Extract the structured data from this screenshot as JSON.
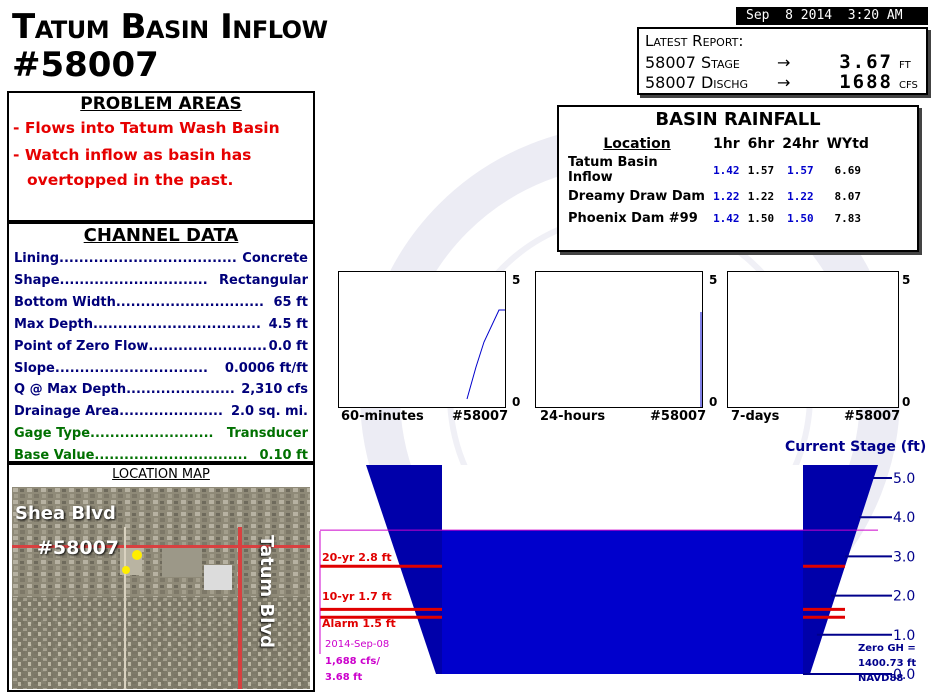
{
  "title": {
    "line1": "Tatum Basin Inflow",
    "line2": "#58007"
  },
  "datetime": "Sep  8 2014  3:20 AM",
  "latest_report": {
    "heading": "Latest Report:",
    "rows": [
      {
        "label": "58007 Stage",
        "arrow": "→",
        "value": "3.67",
        "unit": "FT"
      },
      {
        "label": "58007 Dischg",
        "arrow": "→",
        "value": "1688",
        "unit": "CFS"
      }
    ]
  },
  "problem_areas": {
    "heading": "PROBLEM AREAS",
    "items": [
      "- Flows into Tatum Wash Basin",
      "- Watch inflow as basin has",
      "overtopped in the past."
    ]
  },
  "channel_data": {
    "heading": "CHANNEL DATA",
    "rows": [
      {
        "label": "Lining",
        "dots": "....................................",
        "value": "Concrete"
      },
      {
        "label": "Shape",
        "dots": "..............................",
        "value": "Rectangular"
      },
      {
        "label": "Bottom Width",
        "dots": "..............................",
        "value": "65 ft"
      },
      {
        "label": "Max Depth",
        "dots": "..................................",
        "value": "4.5 ft"
      },
      {
        "label": "Point of Zero Flow",
        "dots": "........................",
        "value": "0.0 ft"
      },
      {
        "label": "Slope",
        "dots": "...............................",
        "value": "0.0006 ft/ft"
      },
      {
        "label": "Q @ Max Depth",
        "dots": "......................",
        "value": "2,310 cfs"
      },
      {
        "label": "Drainage Area",
        "dots": ".....................",
        "value": "2.0 sq. mi."
      },
      {
        "label": "Gage Type",
        "dots": ".........................",
        "value": "Transducer"
      },
      {
        "label": "Base Value",
        "dots": "...............................",
        "value": "0.10 ft"
      }
    ]
  },
  "location_map": {
    "heading": "LOCATION MAP",
    "road1": "Shea Blvd",
    "road2": "Tatum Blvd",
    "gage_label": "#58007"
  },
  "basin_rainfall": {
    "heading": "BASIN RAINFALL",
    "columns": [
      "Location",
      "1hr",
      "6hr",
      "24hr",
      "WYtd"
    ],
    "rows": [
      {
        "name": "Tatum Basin Inflow",
        "v1": "1.42",
        "v6": "1.57",
        "v24": "1.57",
        "wy": "6.69"
      },
      {
        "name": "Dreamy Draw Dam",
        "v1": "1.22",
        "v6": "1.22",
        "v24": "1.22",
        "wy": "8.07"
      },
      {
        "name": "Phoenix Dam #99",
        "v1": "1.42",
        "v6": "1.50",
        "v24": "1.50",
        "wy": "7.83"
      }
    ]
  },
  "mini_charts": [
    {
      "label": "60-minutes",
      "id": "#58007",
      "ymax": "5",
      "ymin": "0"
    },
    {
      "label": "24-hours",
      "id": "#58007",
      "ymax": "5",
      "ymin": "0"
    },
    {
      "label": "7-days",
      "id": "#58007",
      "ymax": "5",
      "ymin": "0"
    }
  ],
  "stage_diagram": {
    "title": "Current Stage (ft)",
    "current_stage": 3.67,
    "max_scale": 5.0,
    "ticks": [
      "5.0",
      "4.0",
      "3.0",
      "2.0",
      "1.0",
      "0.0"
    ],
    "thresholds": [
      {
        "label": "20-yr 2.8 ft",
        "value": 2.8
      },
      {
        "label": "10-yr 1.7 ft",
        "value": 1.7
      },
      {
        "label": "Alarm 1.5 ft",
        "value": 1.5
      }
    ],
    "reading": {
      "date": "2014-Sep-08",
      "flow": "1,688 cfs/",
      "stage": "3.68 ft"
    },
    "zero_gh": [
      "Zero GH =",
      "1400.73 ft",
      "NAVD88"
    ],
    "colors": {
      "water": "#0000cc",
      "channel": "#0000aa",
      "threshold": "#e00000",
      "reading": "#cc00cc"
    }
  }
}
